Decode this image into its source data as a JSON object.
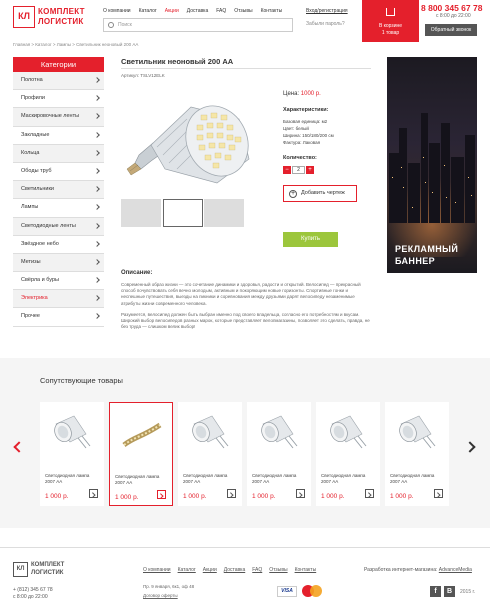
{
  "header": {
    "logo": {
      "mark": "КЛ",
      "line1": "КОМПЛЕКТ",
      "line2": "ЛОГИСТИК"
    },
    "nav": [
      "О компании",
      "Каталог",
      "Акции",
      "Доставка",
      "FAQ",
      "Отзывы",
      "Контакты"
    ],
    "nav_active_index": 2,
    "search_placeholder": "Поиск",
    "login_label": "Вход/регистрация",
    "forgot_label": "Забыли пароль?",
    "cart": {
      "line1": "В корзине",
      "line2": "1 товар"
    },
    "phone": "8 800 345 67 78",
    "hours": "с 8:00 до 22:00",
    "callback_label": "Обратный звонок"
  },
  "breadcrumbs": "Главная > Каталог > Лампы > Светильник неоновый 200 АА",
  "sidebar": {
    "title": "Категории",
    "items": [
      {
        "label": "Полотна",
        "active": false
      },
      {
        "label": "Профили",
        "active": false
      },
      {
        "label": "Маскировочные ленты",
        "active": false
      },
      {
        "label": "Закладные",
        "active": false
      },
      {
        "label": "Кольца",
        "active": false
      },
      {
        "label": "Ободы труб",
        "active": false
      },
      {
        "label": "Светильники",
        "active": false
      },
      {
        "label": "Лампы",
        "active": false
      },
      {
        "label": "Светодиодные ленты",
        "active": false
      },
      {
        "label": "Звёздное небо",
        "active": false
      },
      {
        "label": "Метизы",
        "active": false
      },
      {
        "label": "Свёрла и буры",
        "active": false
      },
      {
        "label": "Электрика",
        "active": true
      },
      {
        "label": "Прочее",
        "active": false
      }
    ]
  },
  "product": {
    "title": "Светильник неоновый 200 АА",
    "article": "Артикул: TSLV12ELK",
    "price_label": "Цена:",
    "price": "1000 р.",
    "specs_title": "Характеристики:",
    "specs": [
      "Базовая единица: м2",
      "Цвет: белый",
      "Ширина: 150/180/200 см",
      "Фактура: Лаковая"
    ],
    "qty_label": "Количество:",
    "qty": "2",
    "add_drawing": "Добавить чертеж",
    "buy": "Купить",
    "desc_title": "Описание:",
    "desc_p1": "Современный образ жизни — это сочетание динамики и здоровья, радости и открытий. Велосипед — прекрасный способ почувствовать себя вечно молодым, активным и покоряющим новые горизонты. Спортивные гонки и неспешные путешествия, выезды на пикники и соревнования между друзьями дарят велосипеду незаменимые атрибуты жизни современного человека.",
    "desc_p2": "Разумеется, велосипед должен быть выбран именно под своего владельца, согласно его потребностям и вкусам. Широкий выбор велосипедов разных марок, которые представляет велопмагазины, позволяет это сделать, правда, не без труда — слишком велик выбор!"
  },
  "banner": {
    "line1": "РЕКЛАМНЫЙ",
    "line2": "БАННЕР"
  },
  "related": {
    "title": "Сопутствующие товары",
    "items": [
      {
        "name": "Светодиодная лампа 2007 АА",
        "price": "1 000 р.",
        "kind": "bulb",
        "selected": false
      },
      {
        "name": "Светодиодная лампа 2007 АА",
        "price": "1 000 р.",
        "kind": "strip",
        "selected": true
      },
      {
        "name": "Светодиодная лампа 2007 АА",
        "price": "1 000 р.",
        "kind": "bulb",
        "selected": false
      },
      {
        "name": "Светодиодная лампа 2007 АА",
        "price": "1 000 р.",
        "kind": "bulb",
        "selected": false
      },
      {
        "name": "Светодиодная лампа 2007 АА",
        "price": "1 000 р.",
        "kind": "bulb",
        "selected": false
      },
      {
        "name": "Светодиодная лампа 2007 АА",
        "price": "1 000 р.",
        "kind": "bulb",
        "selected": false
      }
    ]
  },
  "footer": {
    "logo": {
      "mark": "КЛ",
      "line1": "КОМПЛЕКТ",
      "line2": "ЛОГИСТИК"
    },
    "phone": "+ (812) 345 67 78",
    "hours": "с 8:00 до 22:00",
    "nav": [
      "О компании",
      "Каталог",
      "Акции",
      "Доставка",
      "FAQ",
      "Отзывы",
      "Контакты"
    ],
    "address": "Пр. 9 января, 6к1, оф 48",
    "offer": "Договор оферты",
    "visa": "VISA",
    "dev_prefix": "Разработка интернет-магазина: ",
    "dev_link": "AdvanceMedia",
    "social": [
      "f",
      "В"
    ],
    "year": "2015 г."
  },
  "colors": {
    "accent": "#e4202c",
    "buy": "#9cc63c",
    "callback": "#555555"
  }
}
